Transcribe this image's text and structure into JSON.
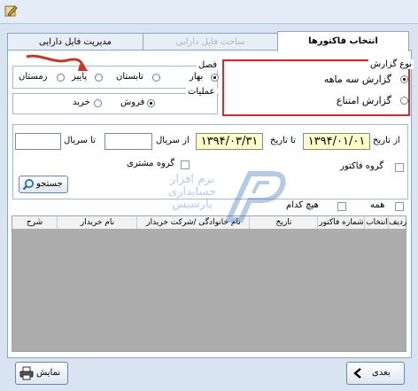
{
  "tabs": [
    {
      "label": "انتخاب فاکتورها",
      "state": "active"
    },
    {
      "label": "ساخت فایل دارایی",
      "state": "disabled"
    },
    {
      "label": "مدیریت فایل دارایی",
      "state": "normal"
    }
  ],
  "report_type": {
    "legend": "نوع گزارش",
    "options": [
      "گزارش سه ماهه",
      "گزارش امتناع"
    ],
    "selected": "گزارش سه ماهه"
  },
  "season": {
    "legend": "فصل",
    "options": [
      "بهار",
      "تابستان",
      "پاییز",
      "زمستان"
    ],
    "selected": "بهار"
  },
  "operations": {
    "legend": "عملیات",
    "options": [
      "فروش",
      "خرید"
    ],
    "selected": "فروش"
  },
  "filters": {
    "from_date_label": "از تاریخ",
    "from_date": "۱۳۹۴/۰۱/۰۱",
    "to_date_label": "تا تاریخ",
    "to_date": "۱۳۹۴/۰۳/۳۱",
    "from_serial_label": "از سریال",
    "from_serial": "",
    "to_serial_label": "تا سریال",
    "to_serial": "",
    "invoice_group_label": "گروه فاکتور",
    "customer_group_label": "گروه مشتری",
    "search_label": "جستجو"
  },
  "select_all_label": "همه",
  "select_none_label": "هیچ کدام",
  "table": {
    "columns": [
      "ردیف",
      "انتخاب",
      "شماره فاکتور",
      "تاریخ",
      "نام خانوادگی /شرکت خریدار",
      "نام خریدار",
      "شرح"
    ],
    "rows": []
  },
  "watermark": "نرم افزار حسابداری پارسیس",
  "footer": {
    "next_label": "بعدی",
    "show_label": "نمایش"
  },
  "colors": {
    "highlight_border": "#d9262b",
    "date_background": "#ffffcc",
    "grid_background": "#acacac",
    "arrow": "#c0392b"
  }
}
